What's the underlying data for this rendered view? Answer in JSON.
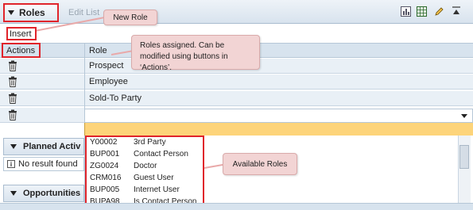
{
  "header": {
    "roles_label": "Roles",
    "edit_list_label": "Edit List",
    "tools": [
      "chart-icon",
      "spreadsheet-icon",
      "pencil-icon",
      "collapse-icon"
    ]
  },
  "callouts": {
    "new_role": "New Role",
    "roles_assigned": "Roles assigned. Can be modified using buttons in ‘Actions’.",
    "available_roles": "Available Roles"
  },
  "insert_label": "Insert",
  "table": {
    "col_actions": "Actions",
    "col_role": "Role",
    "rows": [
      "Prospect",
      "Employee",
      "Sold-To Party"
    ]
  },
  "available_roles": [
    {
      "code": "Y00002",
      "name": "3rd Party"
    },
    {
      "code": "BUP001",
      "name": "Contact Person"
    },
    {
      "code": "ZG0024",
      "name": "Doctor"
    },
    {
      "code": "CRM016",
      "name": "Guest User"
    },
    {
      "code": "BUP005",
      "name": "Internet User"
    },
    {
      "code": "BUPA98",
      "name": "Is Contact Person"
    }
  ],
  "planned_activities": {
    "title": "Planned Activ",
    "no_result": "No result found"
  },
  "opportunities": {
    "title": "Opportunities"
  }
}
